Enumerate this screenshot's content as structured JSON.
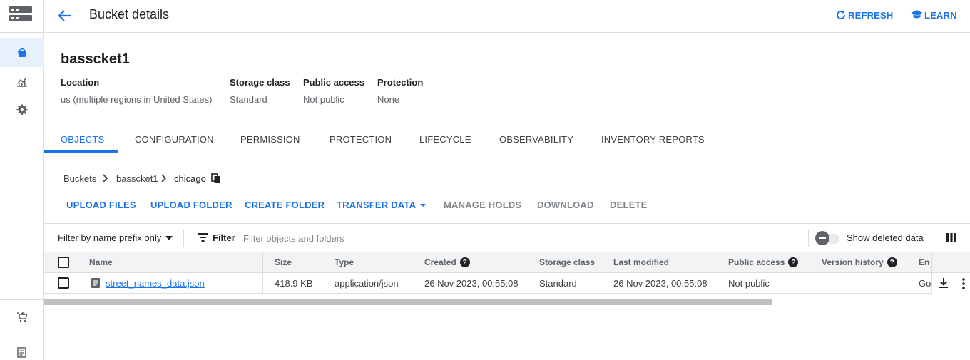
{
  "header": {
    "title": "Bucket details",
    "refresh_label": "REFRESH",
    "learn_label": "LEARN"
  },
  "bucket": {
    "name": "basscket1",
    "meta": [
      {
        "label": "Location",
        "value": "us (multiple regions in United States)"
      },
      {
        "label": "Storage class",
        "value": "Standard"
      },
      {
        "label": "Public access",
        "value": "Not public"
      },
      {
        "label": "Protection",
        "value": "None"
      }
    ]
  },
  "tabs": [
    "OBJECTS",
    "CONFIGURATION",
    "PERMISSION",
    "PROTECTION",
    "LIFECYCLE",
    "OBSERVABILITY",
    "INVENTORY REPORTS"
  ],
  "breadcrumb": [
    "Buckets",
    "basscket1",
    "chicago"
  ],
  "actions": [
    "UPLOAD FILES",
    "UPLOAD FOLDER",
    "CREATE FOLDER",
    "TRANSFER DATA",
    "MANAGE HOLDS",
    "DOWNLOAD",
    "DELETE"
  ],
  "filter": {
    "prefix_label": "Filter by name prefix only",
    "filter_label": "Filter",
    "placeholder": "Filter objects and folders",
    "show_deleted_label": "Show deleted data",
    "show_deleted_on": false
  },
  "table": {
    "columns": [
      "Name",
      "Size",
      "Type",
      "Created",
      "Storage class",
      "Last modified",
      "Public access",
      "Version history",
      "Enc"
    ],
    "rows": [
      {
        "name": "street_names_data.json",
        "size": "418.9 KB",
        "type": "application/json",
        "created": "26 Nov 2023, 00:55:08",
        "storage_class": "Standard",
        "last_modified": "26 Nov 2023, 00:55:08",
        "public_access": "Not public",
        "version_history": "—",
        "encryption": "Go"
      }
    ]
  },
  "icons": {
    "nav": [
      "storage-logo-icon",
      "bucket-icon",
      "monitoring-icon",
      "settings-icon",
      "marketplace-icon",
      "release-notes-icon"
    ],
    "help_glyph": "?"
  },
  "colors": {
    "accent": "#1a73e8",
    "active_nav_bg": "#e8f0fe"
  }
}
